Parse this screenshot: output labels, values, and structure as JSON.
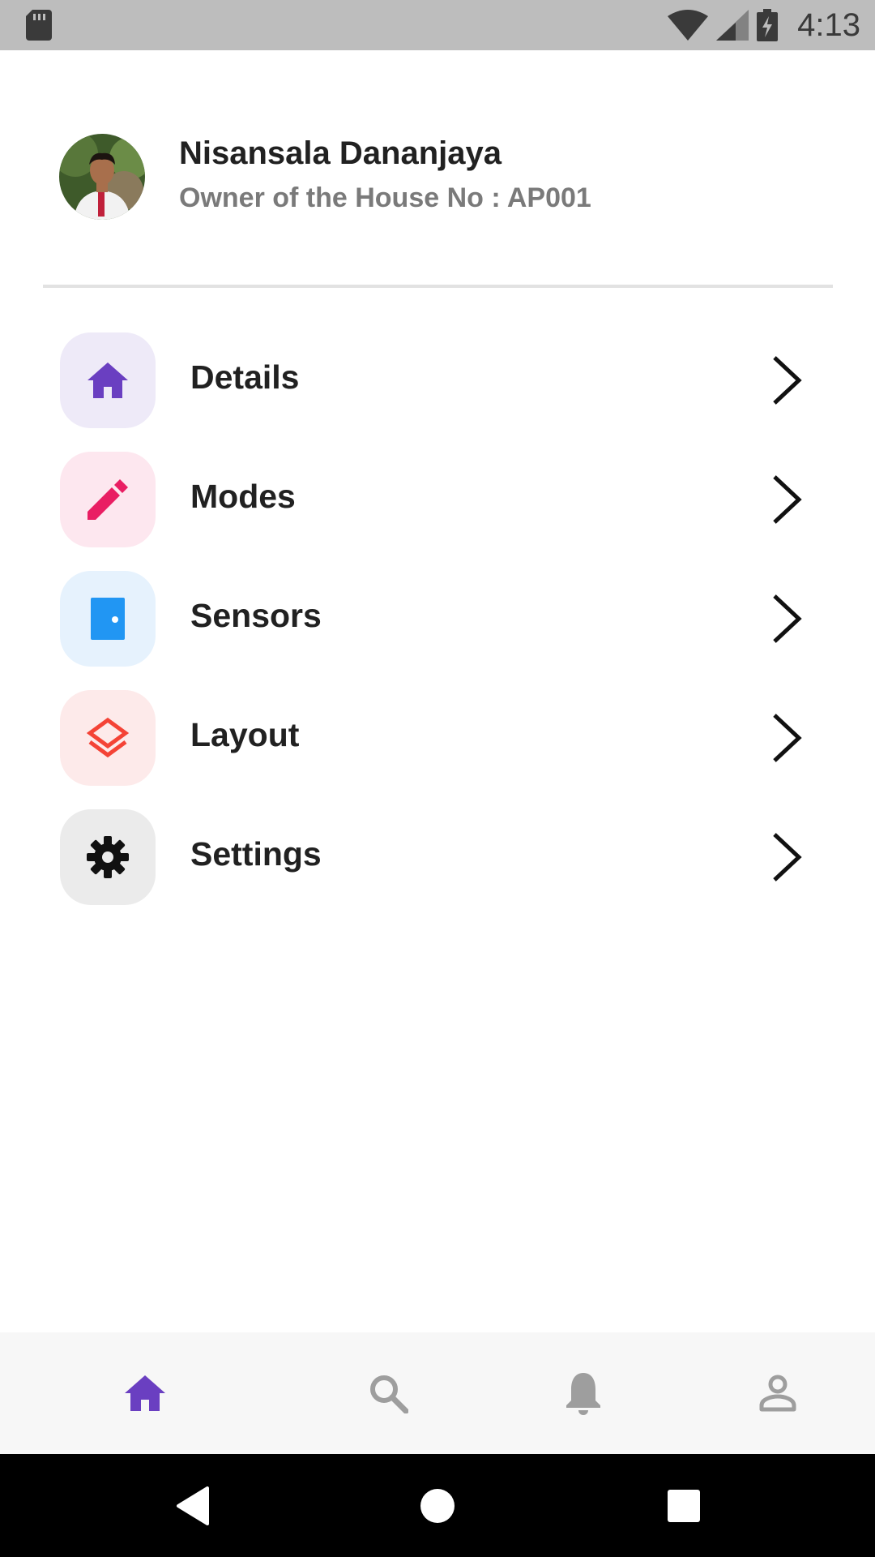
{
  "status_bar": {
    "time": "4:13"
  },
  "profile": {
    "name": "Nisansala Dananjaya",
    "subtitle": "Owner of the House No : AP001"
  },
  "menu": {
    "items": [
      {
        "label": "Details",
        "icon": "home-icon",
        "icon_color": "#6a3fc1",
        "bg_color": "#eeeaf8"
      },
      {
        "label": "Modes",
        "icon": "pencil-icon",
        "icon_color": "#e91e63",
        "bg_color": "#fde7ef"
      },
      {
        "label": "Sensors",
        "icon": "door-icon",
        "icon_color": "#2196f3",
        "bg_color": "#e6f2fd"
      },
      {
        "label": "Layout",
        "icon": "layers-icon",
        "icon_color": "#f44336",
        "bg_color": "#fdeaea"
      },
      {
        "label": "Settings",
        "icon": "gear-icon",
        "icon_color": "#111111",
        "bg_color": "#ebebeb"
      }
    ]
  },
  "bottom_nav": {
    "items": [
      {
        "icon": "home-icon",
        "active": true,
        "color": "#6a3fc1"
      },
      {
        "icon": "search-icon",
        "active": false,
        "color": "#9e9e9e"
      },
      {
        "icon": "bell-icon",
        "active": false,
        "color": "#9e9e9e"
      },
      {
        "icon": "person-icon",
        "active": false,
        "color": "#9e9e9e"
      }
    ]
  },
  "system_nav": {
    "buttons": [
      "back-icon",
      "home-circle-icon",
      "recents-icon"
    ]
  }
}
